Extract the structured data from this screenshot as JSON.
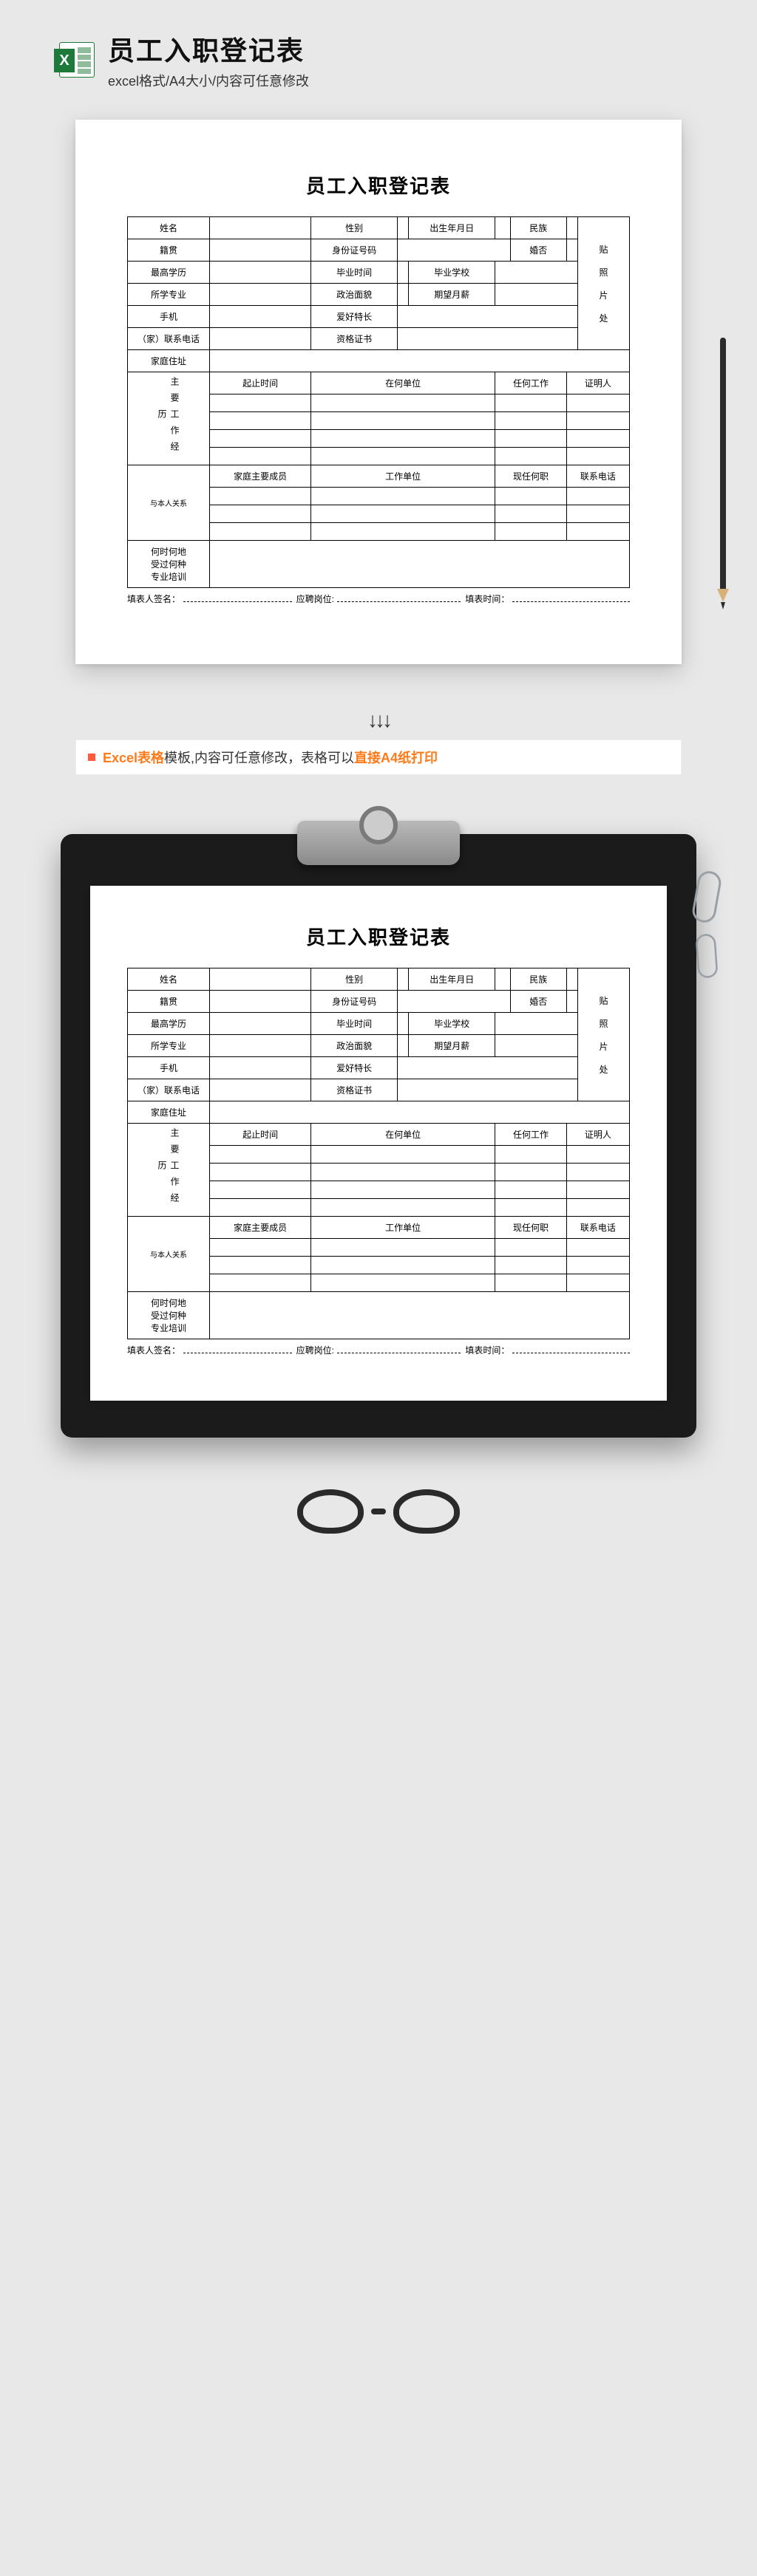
{
  "header": {
    "title": "员工入职登记表",
    "subtitle": "excel格式/A4大小/内容可任意修改"
  },
  "arrows": "↓↓↓",
  "banner": {
    "p1": "Excel表格",
    "p2": "模板,内容可任意修改，表格可以",
    "p3": "直接A4纸打印"
  },
  "form": {
    "title": "员工入职登记表",
    "r1": {
      "c1": "姓名",
      "c2": "性别",
      "c3": "出生年月日",
      "c4": "民族"
    },
    "r2": {
      "c1": "籍贯",
      "c2": "身份证号码",
      "c3": "婚否"
    },
    "r3": {
      "c1": "最高学历",
      "c2": "毕业时间",
      "c3": "毕业学校"
    },
    "r4": {
      "c1": "所学专业",
      "c2": "政治面貌",
      "c3": "期望月薪"
    },
    "r5": {
      "c1": "手机",
      "c2": "爱好特长"
    },
    "r6": {
      "c1": "（家）联系电话",
      "c2": "资格证书"
    },
    "r7": {
      "c1": "家庭住址"
    },
    "photo": {
      "l1": "贴",
      "l2": "照",
      "l3": "片",
      "l4": "处"
    },
    "work": {
      "side": "主要工作经历",
      "h1": "起止时间",
      "h2": "在何单位",
      "h3": "任何工作",
      "h4": "证明人"
    },
    "family": {
      "side": "与本人关系",
      "h1": "家庭主要成员",
      "h2": "工作单位",
      "h3": "现任何职",
      "h4": "联系电话"
    },
    "training": "何时何地\n受过何种\n专业培训",
    "footer": {
      "f1": "填表人签名：",
      "f2": "应聘岗位:",
      "f3": "填表时间："
    }
  }
}
